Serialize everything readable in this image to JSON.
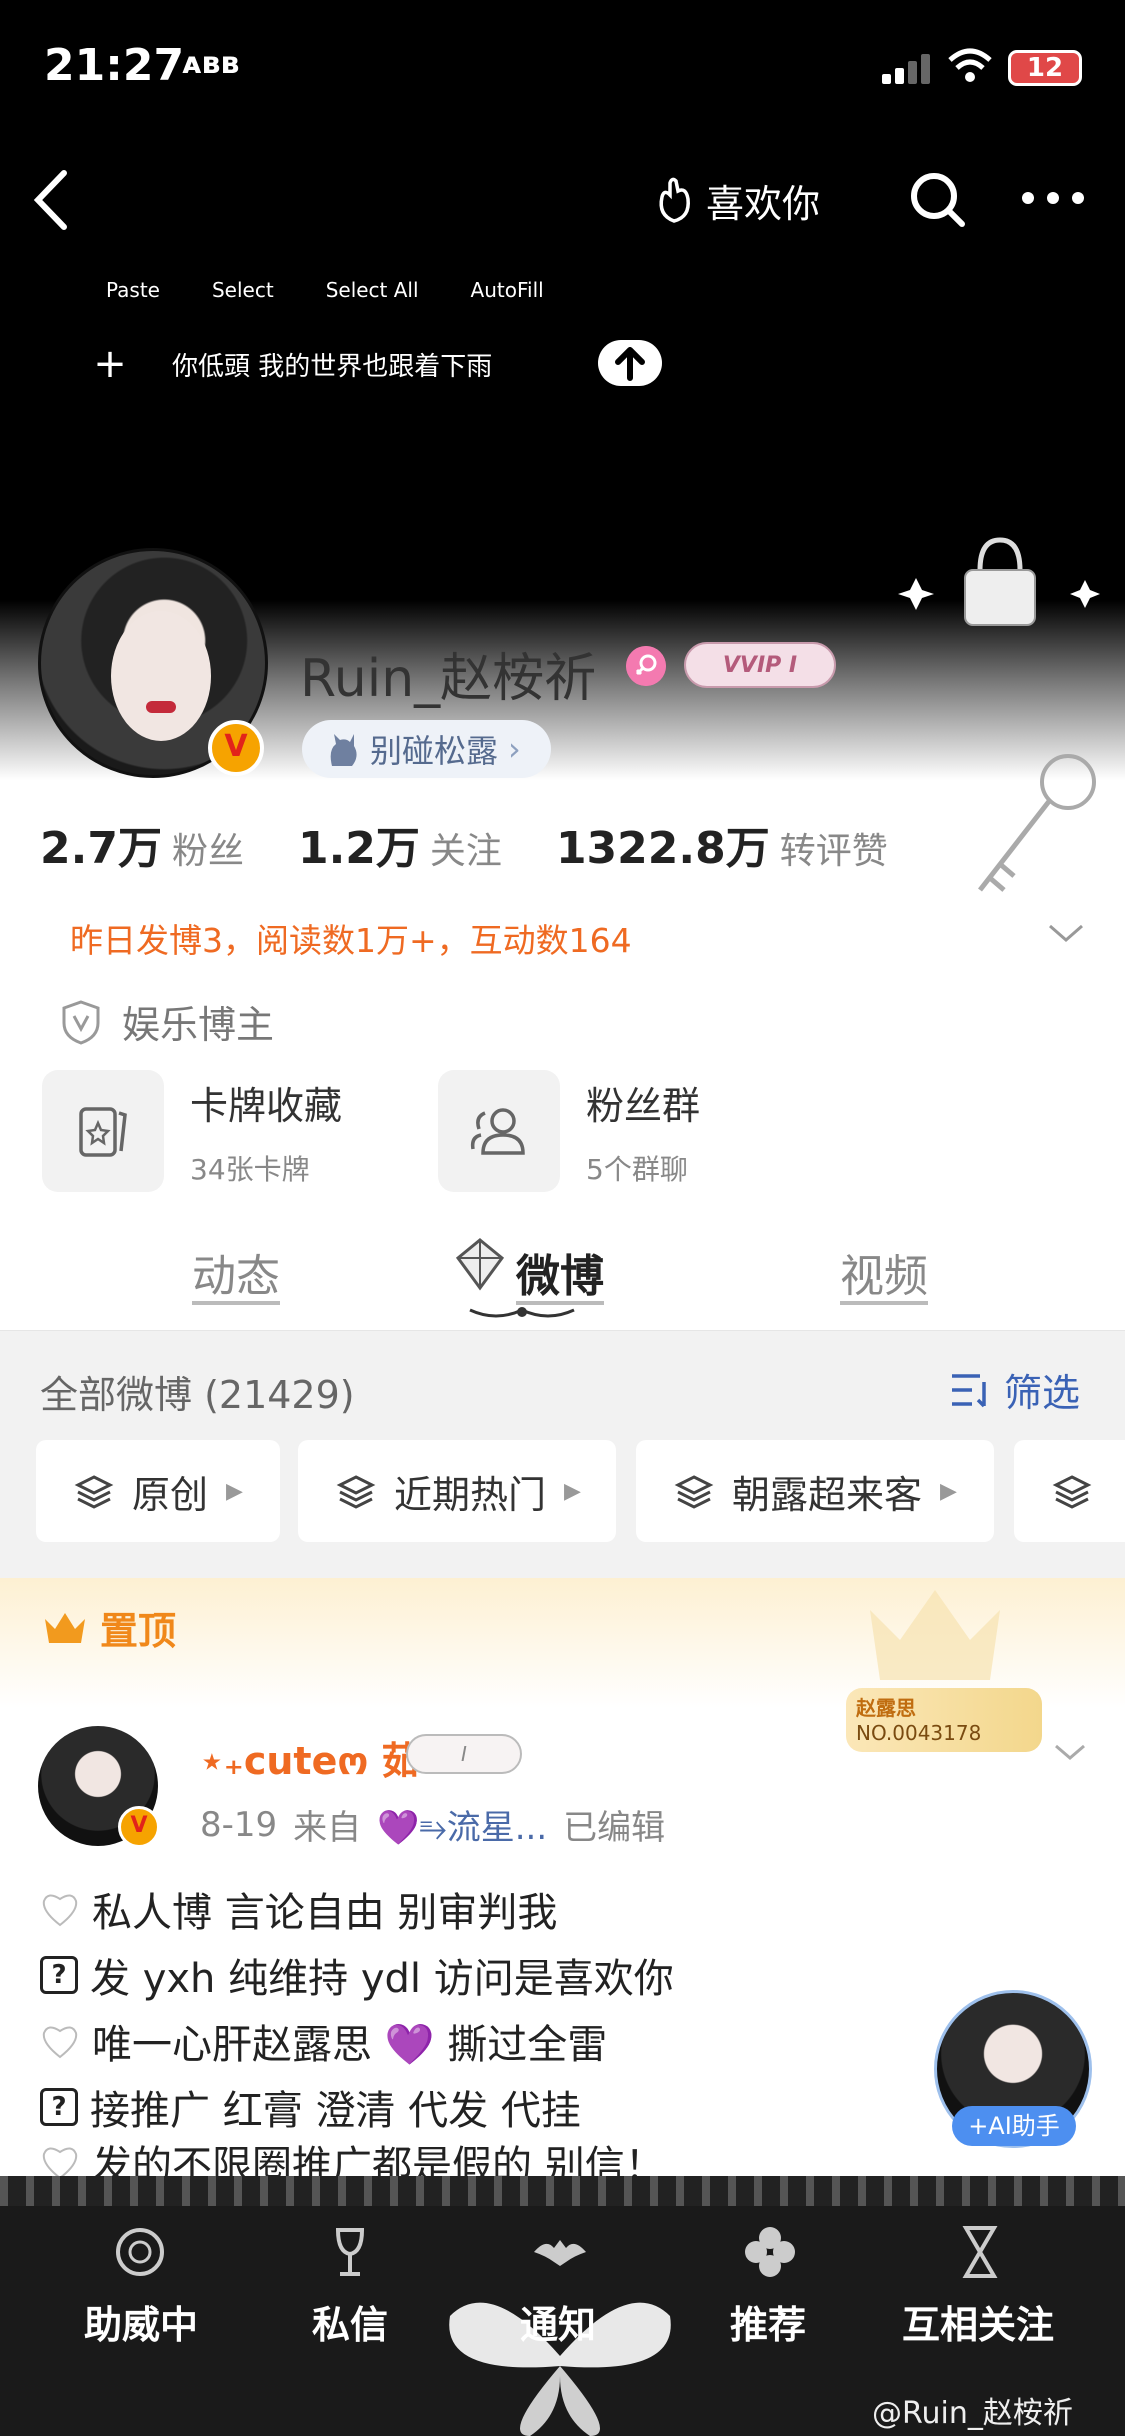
{
  "status_bar": {
    "time": "21:27",
    "extra": "ᴀʙʙ",
    "battery": "12"
  },
  "header": {
    "like_label": "喜欢你"
  },
  "edit_menu": {
    "items": [
      "Paste",
      "Select",
      "Select All",
      "AutoFill"
    ]
  },
  "input": {
    "text": "你低頭 我的世界也跟着下雨"
  },
  "profile": {
    "username": "Ruin_赵桉祈",
    "vip_label": "VVIP I",
    "tag": "别碰松露",
    "v_mark": "V"
  },
  "stats": [
    {
      "num": "2.7万",
      "label": "粉丝"
    },
    {
      "num": "1.2万",
      "label": "关注"
    },
    {
      "num": "1322.8万",
      "label": "转评赞"
    }
  ],
  "activity_text": "昨日发博3，阅读数1万+，互动数164",
  "blogger_type": "娱乐博主",
  "cards": [
    {
      "title": "卡牌收藏",
      "sub": "34张卡牌"
    },
    {
      "title": "粉丝群",
      "sub": "5个群聊"
    }
  ],
  "tabs": [
    "动态",
    "微博",
    "视频"
  ],
  "posts_header": {
    "title": "全部微博 (21429)",
    "filter": "筛选"
  },
  "chips": [
    "原创",
    "近期热门",
    "朝露超来客"
  ],
  "pinned": {
    "label": "置顶",
    "fans_name": "赵露思",
    "fans_no": "NO.0043178"
  },
  "post": {
    "author": "⋆₊cuteო 茹",
    "badge": "I",
    "date": "8-19",
    "from": "来自",
    "source": "💜⥱流星...",
    "edited": "已编辑",
    "lines": [
      {
        "icon": "heart",
        "text": "私人博 言论自由 别审判我"
      },
      {
        "icon": "box",
        "text": "发 yxh 纯维持 ydl 访问是喜欢你"
      },
      {
        "icon": "heart",
        "text": "唯一心肝赵露思 💜 撕过全雷"
      },
      {
        "icon": "box",
        "text": "接推广 红膏 澄清 代发 代挂"
      },
      {
        "icon": "heart",
        "text": "发的不限圈推广都是假的 别信！"
      }
    ]
  },
  "ai_helper": "+AI助手",
  "bottom_nav": [
    "助威中",
    "私信",
    "通知",
    "推荐",
    "互相关注"
  ],
  "watermark": "@Ruin_赵桉祈"
}
